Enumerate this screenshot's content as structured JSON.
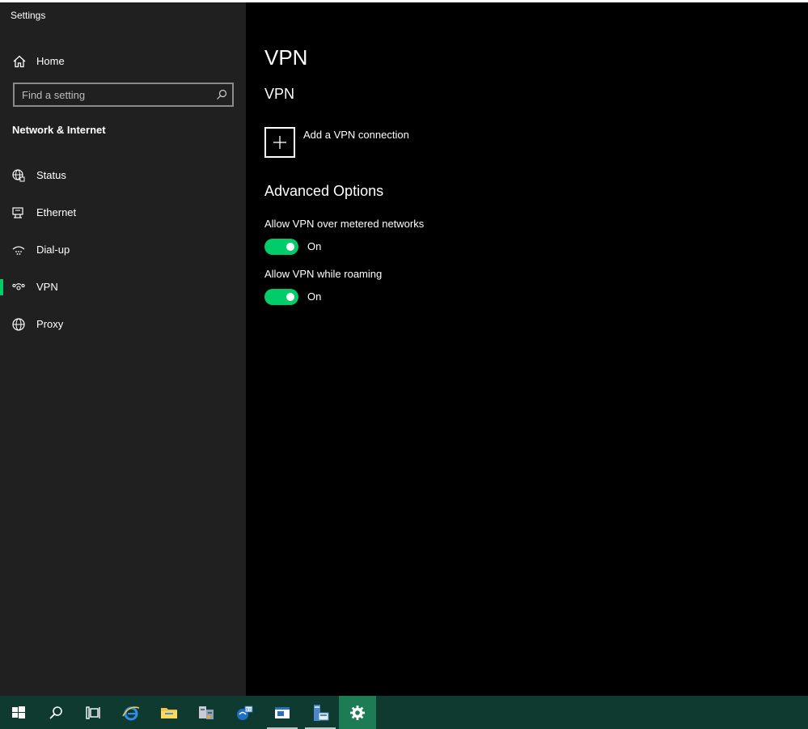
{
  "window": {
    "title": "Settings"
  },
  "sidebar": {
    "home_label": "Home",
    "search_placeholder": "Find a setting",
    "section_label": "Network & Internet",
    "items": [
      {
        "label": "Status",
        "icon": "globe-status-icon",
        "selected": false
      },
      {
        "label": "Ethernet",
        "icon": "ethernet-icon",
        "selected": false
      },
      {
        "label": "Dial-up",
        "icon": "dial-up-icon",
        "selected": false
      },
      {
        "label": "VPN",
        "icon": "vpn-icon",
        "selected": true
      },
      {
        "label": "Proxy",
        "icon": "globe-proxy-icon",
        "selected": false
      }
    ]
  },
  "main": {
    "title": "VPN",
    "subtitle": "VPN",
    "add_connection_label": "Add a VPN connection",
    "advanced_title": "Advanced Options",
    "options": [
      {
        "label": "Allow VPN over metered networks",
        "state": "On",
        "enabled": true
      },
      {
        "label": "Allow VPN while roaming",
        "state": "On",
        "enabled": true
      }
    ]
  },
  "colors": {
    "accent": "#00cc6a",
    "sidebar_bg": "#202020",
    "main_bg": "#000000",
    "taskbar_bg": "#0f3a30"
  },
  "taskbar": {
    "items": [
      "start-icon",
      "search-icon",
      "task-view-icon",
      "internet-explorer-icon",
      "file-explorer-icon",
      "server-manager-icon",
      "network-app-icon",
      "window-app-icon",
      "remote-desktop-icon",
      "settings-icon"
    ]
  }
}
